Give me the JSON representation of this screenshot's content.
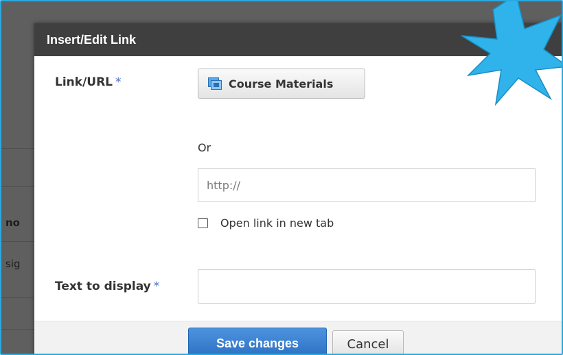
{
  "background": {
    "cut_text_1": "no",
    "cut_text_2": "sig"
  },
  "dialog": {
    "title": "Insert/Edit Link",
    "link_url_label": "Link/URL",
    "required_mark": "*",
    "course_materials_button": "Course Materials",
    "or_text": "Or",
    "url_placeholder": "http://",
    "url_value": "",
    "open_new_tab_label": "Open link in new tab",
    "open_new_tab_checked": false,
    "text_to_display_label": "Text to display",
    "text_to_display_value": "",
    "save_button": "Save changes",
    "cancel_button": "Cancel"
  },
  "icons": {
    "course_materials": "course-materials-icon",
    "callout": "starburst-callout"
  },
  "colors": {
    "header_bg": "#3f3f3f",
    "primary_button": "#2a6fc1",
    "required_asterisk": "#4a70c2",
    "callout_fill": "#2fb3ea",
    "frame_border": "#29a9e0"
  }
}
